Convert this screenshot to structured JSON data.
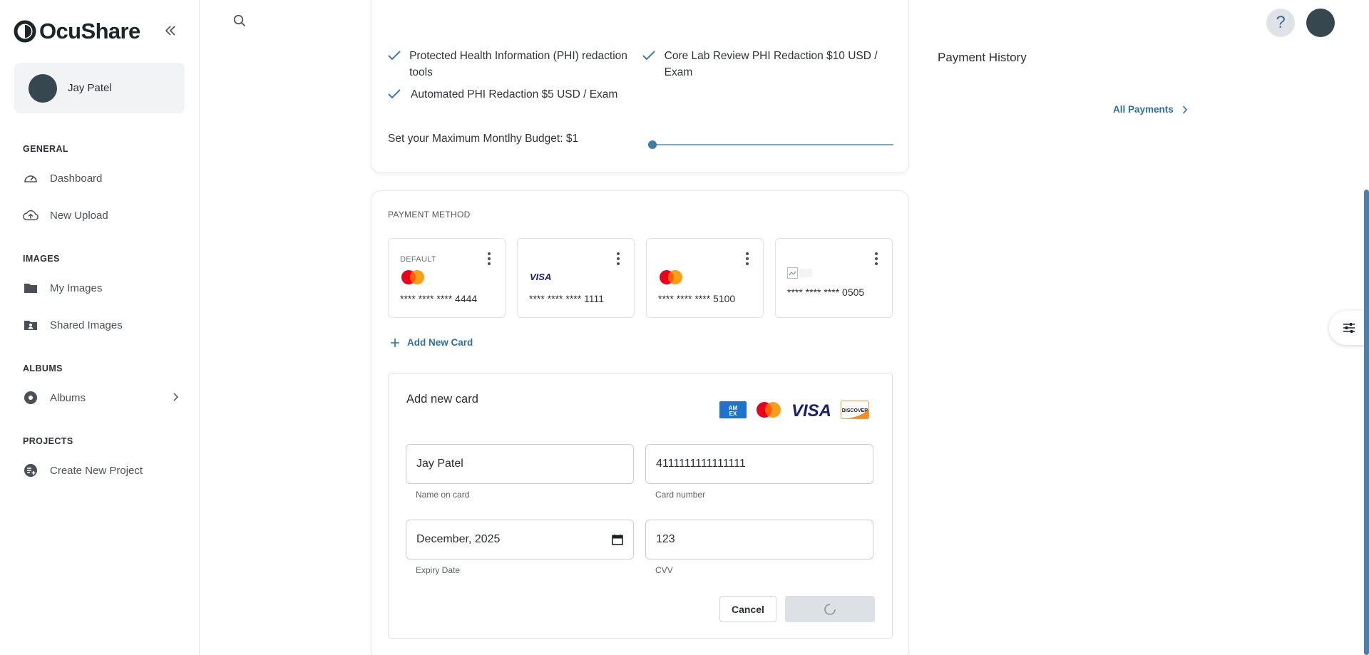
{
  "app": {
    "name": "OcuShare"
  },
  "user": {
    "name": "Jay Patel"
  },
  "sidebar": {
    "sections": [
      {
        "title": "GENERAL",
        "items": [
          {
            "label": "Dashboard",
            "icon": "gauge-icon"
          },
          {
            "label": "New Upload",
            "icon": "cloud-upload-icon"
          }
        ]
      },
      {
        "title": "IMAGES",
        "items": [
          {
            "label": "My Images",
            "icon": "folder-icon"
          },
          {
            "label": "Shared Images",
            "icon": "shared-folder-icon"
          }
        ]
      },
      {
        "title": "ALBUMS",
        "items": [
          {
            "label": "Albums",
            "icon": "album-icon"
          }
        ]
      },
      {
        "title": "PROJECTS",
        "items": [
          {
            "label": "Create New Project",
            "icon": "add-project-icon"
          }
        ]
      }
    ]
  },
  "plan": {
    "features": [
      "Protected Health Information (PHI) redaction tools",
      "Core Lab Review PHI Redaction $10 USD / Exam",
      "Automated PHI Redaction $5 USD / Exam"
    ],
    "budget_label": "Set your Maximum Montlhy Budget: $1",
    "budget_value": 1
  },
  "payment_history": {
    "title": "Payment History",
    "all_payments_label": "All Payments"
  },
  "payment_method": {
    "title": "PAYMENT METHOD",
    "default_label": "DEFAULT",
    "cards": [
      {
        "brand": "mastercard",
        "number": "**** **** **** 4444",
        "is_default": true
      },
      {
        "brand": "visa",
        "number": "**** **** **** 1111",
        "is_default": false
      },
      {
        "brand": "mastercard",
        "number": "**** **** **** 5100",
        "is_default": false
      },
      {
        "brand": "unknown",
        "number": "**** **** **** 0505",
        "is_default": false
      }
    ],
    "add_card_label": "Add New Card"
  },
  "new_card_form": {
    "title": "Add new card",
    "accepted_brands": [
      "amex",
      "mastercard",
      "visa",
      "discover"
    ],
    "name_value": "Jay Patel",
    "name_hint": "Name on card",
    "number_value": "4111111111111111",
    "number_hint": "Card number",
    "expiry_value": "December, 2025",
    "expiry_hint": "Expiry Date",
    "cvv_value": "123",
    "cvv_hint": "CVV",
    "cancel_label": "Cancel",
    "submit_state": "loading"
  },
  "colors": {
    "accent": "#2f6f9f",
    "mastercard_red": "#eb001b",
    "mastercard_orange": "#f79e1b",
    "visa_blue": "#1a1f71"
  }
}
